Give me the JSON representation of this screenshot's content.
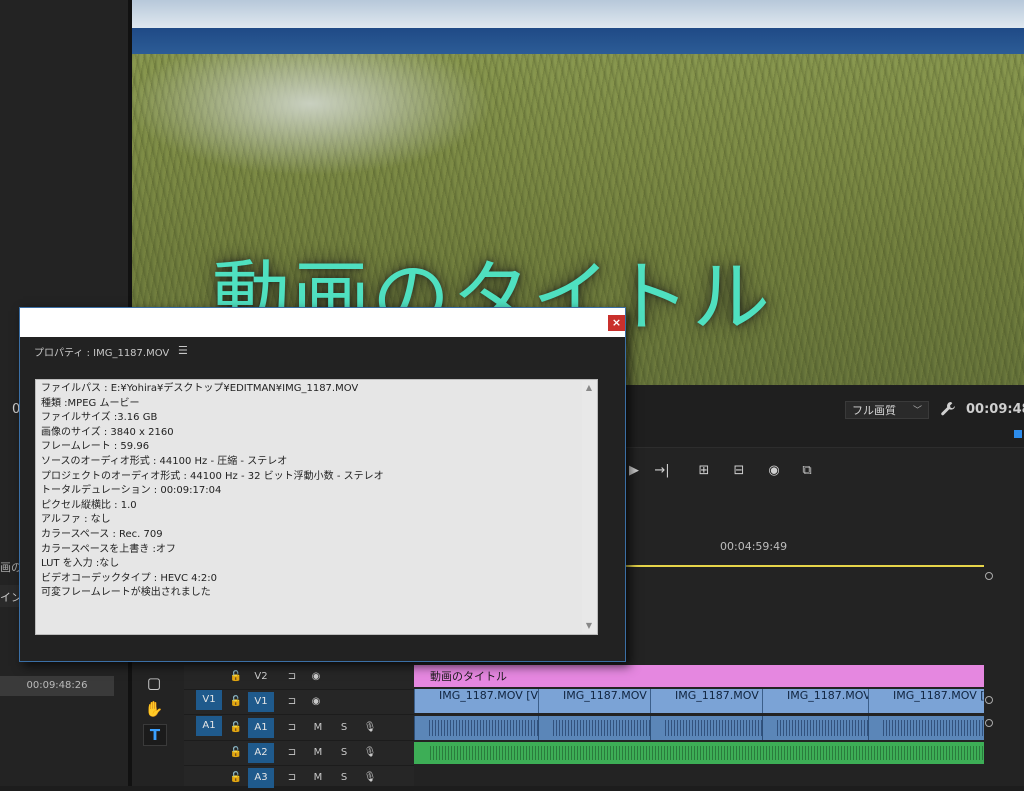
{
  "video": {
    "title_text": "動画のタイトル"
  },
  "monitor": {
    "zoom_value": "フル画質",
    "timecode": "00:09:48:",
    "left_timecode": "0"
  },
  "transport": {
    "buttons": [
      {
        "name": "play-icon",
        "glyph": "▶"
      },
      {
        "name": "step-forward-icon",
        "glyph": "→|"
      },
      {
        "name": "insert-icon",
        "glyph": "⊞"
      },
      {
        "name": "overwrite-icon",
        "glyph": "⊟"
      },
      {
        "name": "export-frame-icon",
        "glyph": "◉"
      },
      {
        "name": "compare-icon",
        "glyph": "⧉"
      }
    ]
  },
  "timeline": {
    "ruler_timecode": "00:04:59:49",
    "title_clip": "動画のタイトル",
    "video_clips": [
      "IMG_1187.MOV [V]",
      "IMG_1187.MOV [",
      "IMG_1187.MOV [",
      "IMG_1187.MOV",
      "IMG_1187.MOV ["
    ],
    "tracks": [
      {
        "id": "v2",
        "label": "V2"
      },
      {
        "id": "v1",
        "label": "V1",
        "source": "V1"
      },
      {
        "id": "a1",
        "label": "A1",
        "source": "A1",
        "m": "M",
        "s": "S"
      },
      {
        "id": "a2",
        "label": "A2",
        "m": "M",
        "s": "S"
      },
      {
        "id": "a3",
        "label": "A3",
        "m": "M",
        "s": "S"
      }
    ]
  },
  "left_panel": {
    "row0": "画の",
    "row1": "イン",
    "time": "00:09:48:26"
  },
  "dialog": {
    "panel_title": "プロパティ : IMG_1187.MOV",
    "close_label": "×",
    "lines": [
      "ファイルパス : E:¥Yohira¥デスクトップ¥EDITMAN¥IMG_1187.MOV",
      "種類 :MPEG ムービー",
      "ファイルサイズ :3.16 GB",
      "画像のサイズ : 3840 x 2160",
      "フレームレート : 59.96",
      "ソースのオーディオ形式 : 44100 Hz - 圧縮 - ステレオ",
      "プロジェクトのオーディオ形式 : 44100 Hz - 32 ビット浮動小数 - ステレオ",
      "トータルデュレーション : 00:09:17:04",
      "ピクセル縦横比 : 1.0",
      "アルファ : なし",
      "カラースペース : Rec. 709",
      "カラースペースを上書き :オフ",
      "LUT を入力 :なし",
      "ビデオコーデックタイプ : HEVC 4:2:0",
      "可変フレームレートが検出されました"
    ]
  }
}
